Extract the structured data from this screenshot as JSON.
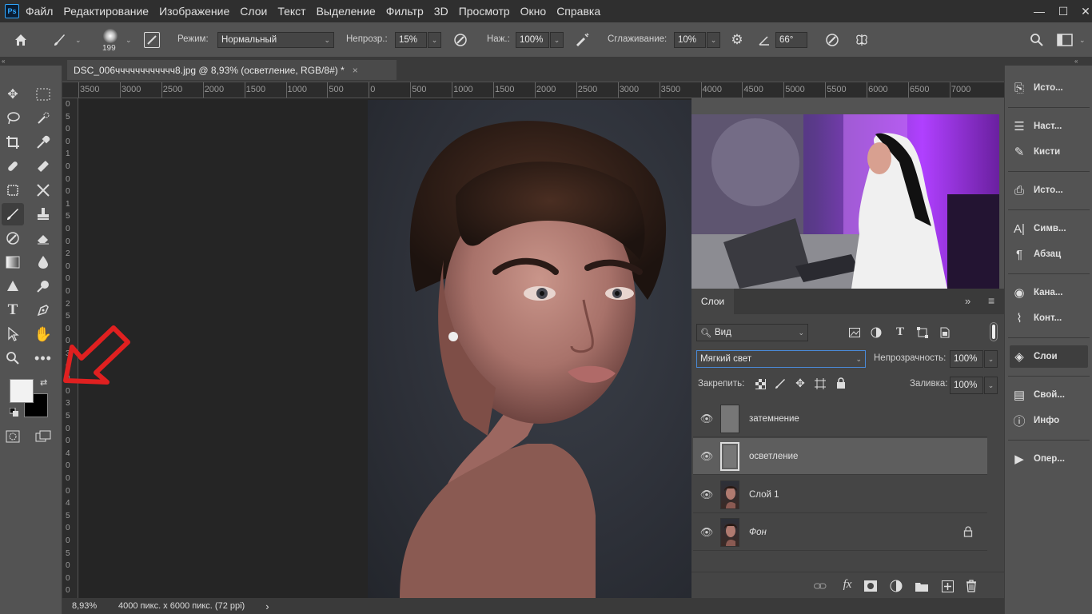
{
  "menu": {
    "logo": "Ps",
    "items": [
      "Файл",
      "Редактирование",
      "Изображение",
      "Слои",
      "Текст",
      "Выделение",
      "Фильтр",
      "3D",
      "Просмотр",
      "Окно",
      "Справка"
    ]
  },
  "window_controls": {
    "minimize": "—",
    "maximize": "☐",
    "close": "✕"
  },
  "options": {
    "brush_size": "199",
    "mode_label": "Режим:",
    "mode_value": "Нормальный",
    "opacity_label": "Непрозр.:",
    "opacity_value": "15%",
    "flow_label": "Наж.:",
    "flow_value": "100%",
    "smoothing_label": "Сглаживание:",
    "smoothing_value": "10%",
    "angle_value": "66°"
  },
  "document": {
    "tab_title": "DSC_006чччччччччччч8.jpg @ 8,93% (осветление, RGB/8#) *",
    "close": "×",
    "ruler_top": [
      "3500",
      "3000",
      "2500",
      "2000",
      "1500",
      "1000",
      "500",
      "0",
      "500",
      "1000",
      "1500",
      "2000",
      "2500",
      "3000",
      "3500",
      "4000",
      "4500",
      "5000",
      "5500",
      "6000",
      "6500",
      "7000"
    ],
    "ruler_left": [
      "0",
      "5",
      "0",
      "0",
      "1",
      "0",
      "0",
      "0",
      "1",
      "5",
      "0",
      "0",
      "2",
      "0",
      "0",
      "0",
      "2",
      "5",
      "0",
      "0",
      "3",
      "0",
      "0",
      "0",
      "3",
      "5",
      "0",
      "0",
      "4",
      "0",
      "0",
      "0",
      "4",
      "5",
      "0",
      "0",
      "5",
      "0",
      "0",
      "0"
    ],
    "zoom": "8,93%",
    "info": "4000 пикс. x 6000 пикс. (72 ppi)",
    "info_arrow": "›"
  },
  "layers_panel": {
    "tab": "Слои",
    "menu_icon": "≡",
    "collapse": "»",
    "filter_kind": "Вид",
    "blend_mode": "Мягкий свет",
    "opacity_label": "Непрозрачность:",
    "opacity_value": "100%",
    "lock_label": "Закрепить:",
    "fill_label": "Заливка:",
    "fill_value": "100%",
    "layers": [
      {
        "name": "затемнение",
        "selected": false,
        "thumb": "gray"
      },
      {
        "name": "осветление",
        "selected": true,
        "thumb": "gray"
      },
      {
        "name": "Слой 1",
        "selected": false,
        "thumb": "photo"
      },
      {
        "name": "Фон",
        "selected": false,
        "thumb": "photo",
        "locked": true
      }
    ]
  },
  "dock": {
    "items": [
      {
        "icon": "history-icon",
        "label": "Исто..."
      },
      {
        "icon": "brush-settings-icon",
        "label": "Наст..."
      },
      {
        "icon": "brushes-icon",
        "label": "Кисти"
      },
      {
        "icon": "clone-source-icon",
        "label": "Исто..."
      },
      {
        "icon": "character-icon",
        "label": "Симв..."
      },
      {
        "icon": "paragraph-icon",
        "label": "Абзац"
      },
      {
        "icon": "channels-icon",
        "label": "Кана..."
      },
      {
        "icon": "paths-icon",
        "label": "Конт..."
      },
      {
        "icon": "layers-icon",
        "label": "Слои"
      },
      {
        "icon": "properties-icon",
        "label": "Свой..."
      },
      {
        "icon": "info-icon",
        "label": "Инфо"
      },
      {
        "icon": "actions-icon",
        "label": "Опер..."
      }
    ]
  },
  "colors": {
    "menubar": "#2f2f2f",
    "panel": "#535353",
    "canvas": "#252525",
    "accent_arrow": "#e02020",
    "video_purple": "#8a2be2"
  }
}
